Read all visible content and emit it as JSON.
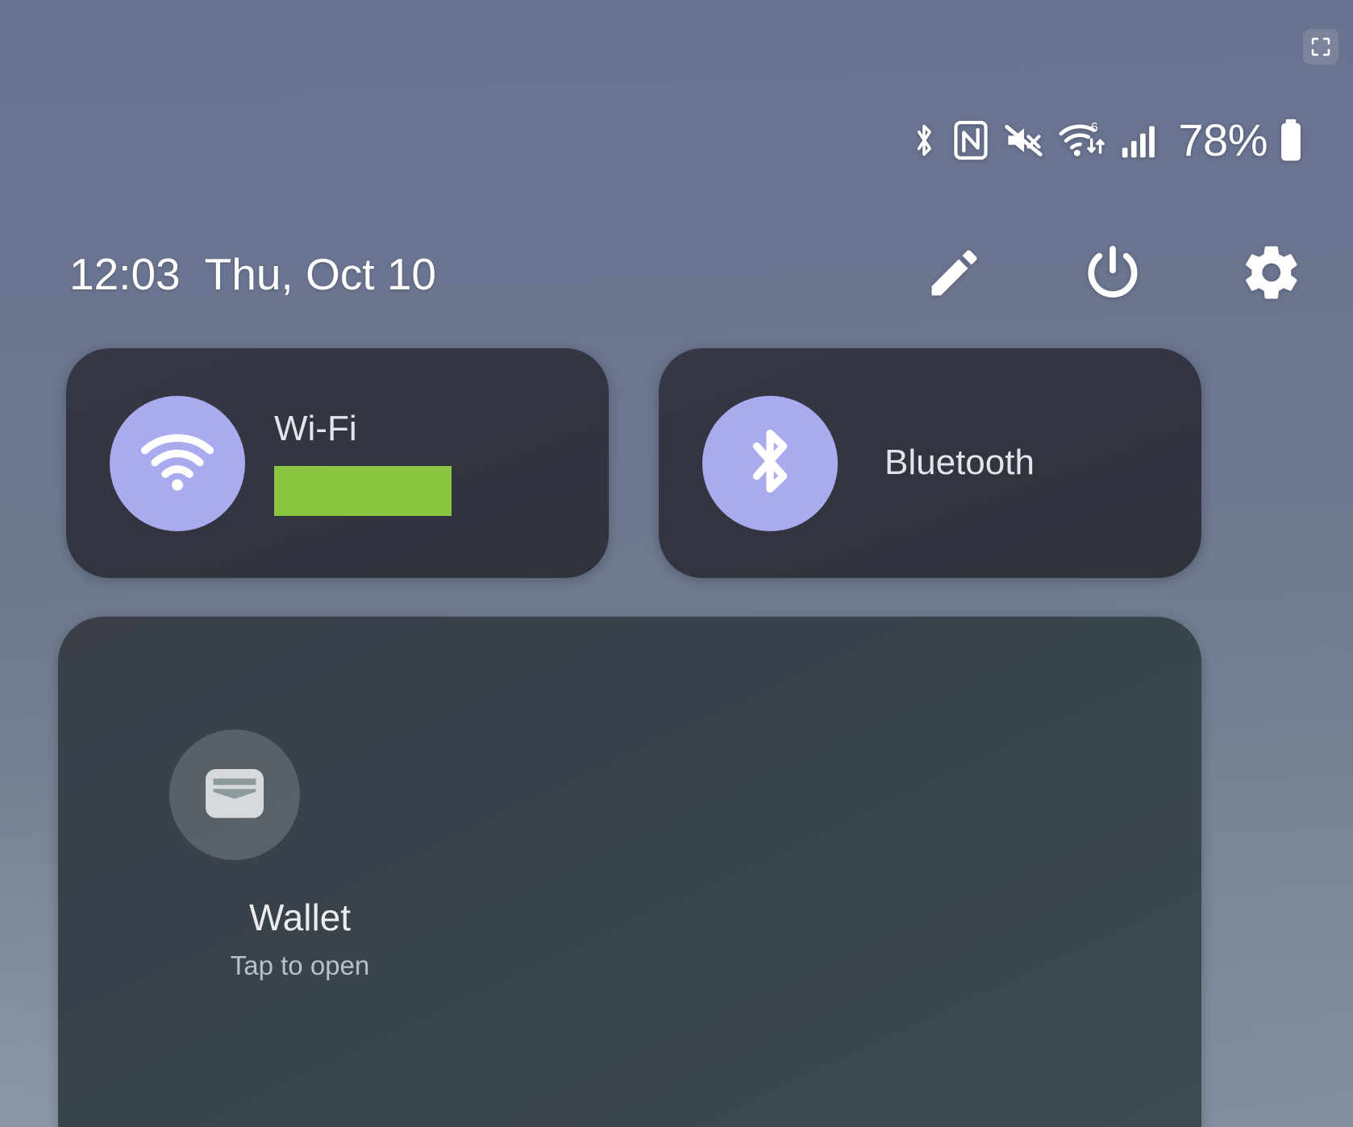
{
  "screen": {
    "title": "Android Quick Settings Panel",
    "background_top_color": "#69728f",
    "background_bottom_color": "#8d99a1"
  },
  "fullscreen_button": {
    "icon": "fullscreen-expand-icon",
    "label": ""
  },
  "status_bar": {
    "icons": [
      {
        "name": "bluetooth-icon",
        "label": "Bluetooth"
      },
      {
        "name": "nfc-icon",
        "label": "NFC"
      },
      {
        "name": "volume-mute-icon",
        "label": "Muted"
      },
      {
        "name": "wifi-6-icon",
        "label": "Wi-Fi 6 with data transfer"
      },
      {
        "name": "cellular-signal-icon",
        "label": "Mobile signal"
      }
    ],
    "battery_percent": "78%",
    "battery_icon": "battery-icon"
  },
  "header": {
    "time": "12:03",
    "date": "Thu, Oct 10",
    "actions": [
      {
        "name": "edit-button",
        "icon": "pencil-icon",
        "label": "Edit"
      },
      {
        "name": "power-button",
        "icon": "power-icon",
        "label": "Power"
      },
      {
        "name": "settings-button",
        "icon": "gear-icon",
        "label": "Settings"
      }
    ]
  },
  "tiles": [
    {
      "name": "wifi-tile",
      "label": "Wi-Fi",
      "icon": "wifi-icon",
      "state": "on",
      "sub_label_redacted": true,
      "redaction_color": "#8cc540",
      "icon_bg": "#a9abee",
      "tile_bg": "#33363f"
    },
    {
      "name": "bluetooth-tile",
      "label": "Bluetooth",
      "icon": "bluetooth-icon",
      "state": "on",
      "sub_label_redacted": false,
      "icon_bg": "#a9abee",
      "tile_bg": "#33363f"
    }
  ],
  "wallet_card": {
    "name": "wallet-card",
    "icon": "wallet-icon",
    "title": "Wallet",
    "subtitle": "Tap to open"
  }
}
